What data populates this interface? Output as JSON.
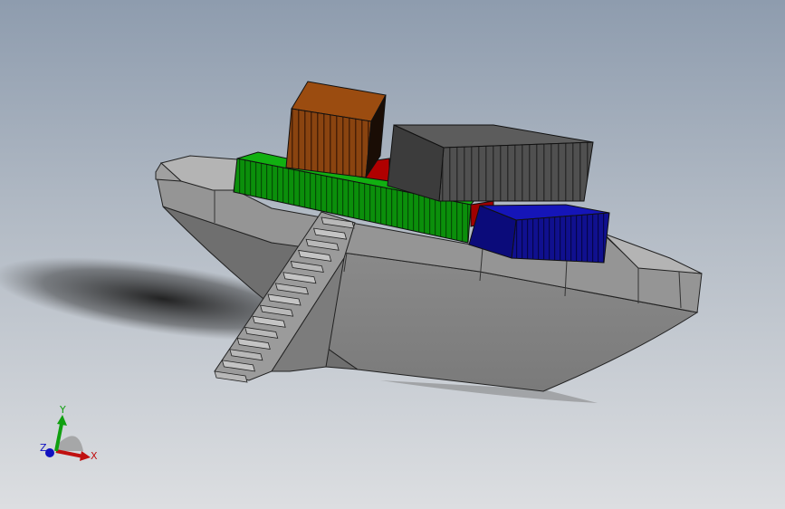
{
  "viewport": {
    "background_top": "#8e9cae",
    "background_bottom": "#dcdee1"
  },
  "model": {
    "hull_color": "#8a8a8a",
    "containers": [
      {
        "name": "orange-container",
        "color": "#8a4410"
      },
      {
        "name": "gray-container",
        "color": "#4d4d4d"
      },
      {
        "name": "green-container",
        "color": "#0a8a0a"
      },
      {
        "name": "blue-container",
        "color": "#0f0f8c"
      },
      {
        "name": "red-container",
        "color": "#b00000"
      }
    ]
  },
  "triad": {
    "x_label": "X",
    "y_label": "Y",
    "z_label": "Z",
    "x_color": "#c01010",
    "y_color": "#10a010",
    "z_color": "#1010c0"
  }
}
